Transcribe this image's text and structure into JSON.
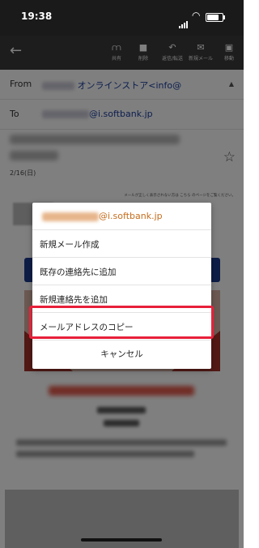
{
  "status_bar": {
    "time": "19:38",
    "battery_level": 0.8
  },
  "toolbar": {
    "items": [
      {
        "label": "共有",
        "icon": "share-icon"
      },
      {
        "label": "削除",
        "icon": "trash-icon"
      },
      {
        "label": "返信/転送",
        "icon": "reply-icon"
      },
      {
        "label": "新規メール",
        "icon": "mail-icon"
      },
      {
        "label": "移動",
        "icon": "folder-icon"
      }
    ]
  },
  "mail": {
    "from_label": "From",
    "from_value": "オンラインストア<info@",
    "to_label": "To",
    "to_value": "@i.softbank.jp",
    "date": "2/16(日)",
    "notice": "メールが正しく表示されない方は こちら のページをご覧ください。"
  },
  "dialog": {
    "address": "@i.softbank.jp",
    "items": [
      "新規メール作成",
      "既存の連絡先に追加",
      "新規連絡先を追加",
      "メールアドレスのコピー"
    ],
    "cancel": "キャンセル"
  },
  "colors": {
    "highlight": "#e8203a",
    "link": "#1a3d9e",
    "address": "#c56d1c"
  }
}
